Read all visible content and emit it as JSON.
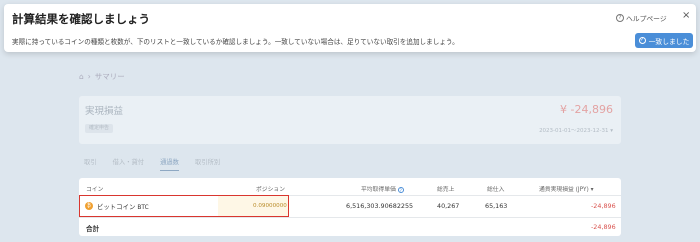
{
  "modal": {
    "title": "計算結果を確認しましょう",
    "description": "実際に持っているコインの種類と枚数が、下のリストと一致しているか確認しましょう。一致していない場合は、足りていない取引を追加しましょう。",
    "help_label": "ヘルプページ",
    "close_label": "×",
    "confirm_label": "一致しました"
  },
  "breadcrumb": {
    "sep": "›",
    "label": "サマリー"
  },
  "card": {
    "title": "実現損益",
    "badge": "確定申告",
    "amount": "¥ -24,896",
    "date_range": "2023-01-01〜2023-12-31 ▾"
  },
  "tabs": [
    "取引",
    "借入・貸付",
    "通過数",
    "取引所別"
  ],
  "table": {
    "headers": {
      "coin": "コイン",
      "position": "ポジション",
      "avg_price": "平均取得単価",
      "total_sell": "総売上",
      "total_buy": "総仕入",
      "pnl": "通貨実現損益 (JPY) ▾"
    },
    "rows": [
      {
        "coin_icon": "₿",
        "coin": "ビットコイン",
        "symbol": "BTC",
        "position": "0.09000000",
        "avg_price": "6,516,303.90682255",
        "total_sell": "40,267",
        "total_buy": "65,163",
        "pnl": "-24,896"
      }
    ],
    "total": {
      "label": "合計",
      "pnl": "-24,896"
    }
  },
  "colors": {
    "accent": "#4a8ed8",
    "negative": "#d9534f",
    "highlight_border": "#d9362f",
    "btc": "#f0a030"
  }
}
